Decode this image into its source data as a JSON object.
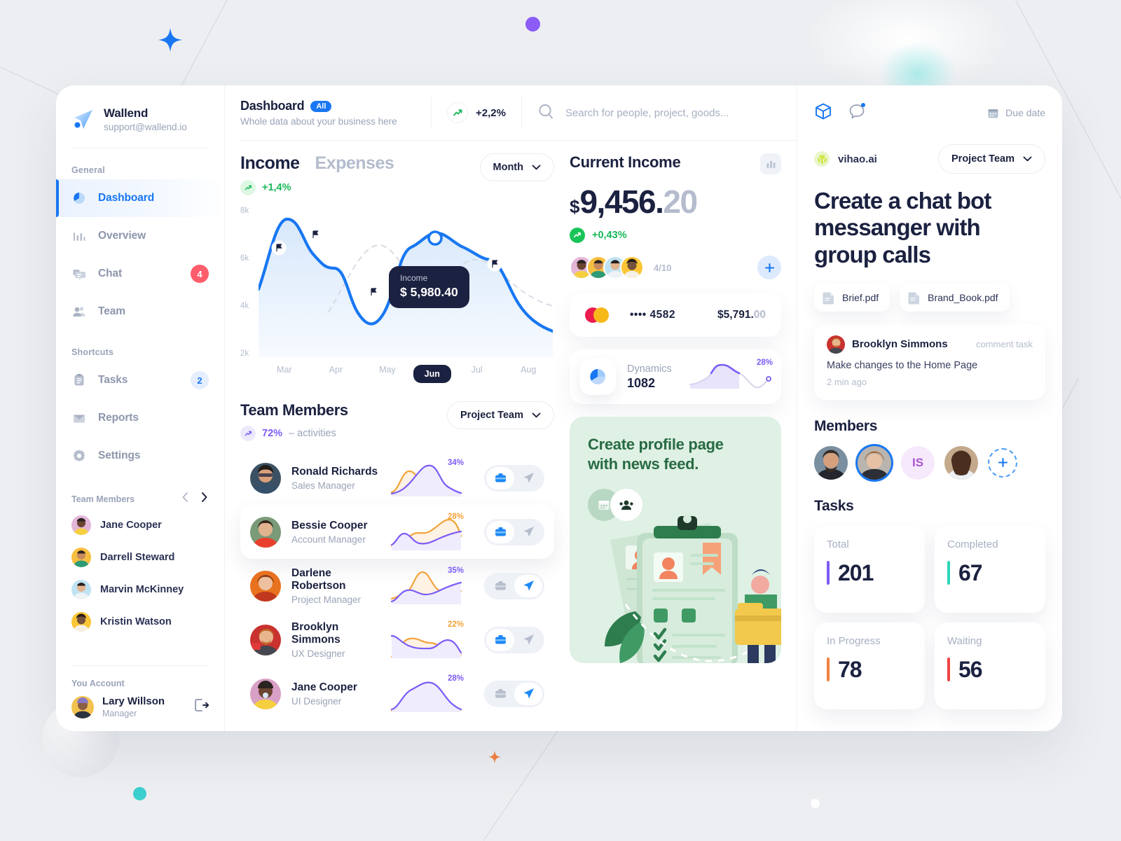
{
  "brand": {
    "name": "Wallend",
    "email": "support@wallend.io",
    "logo_icon": "paper-plane-logo"
  },
  "sidebar": {
    "sections": [
      {
        "label": "General",
        "items": [
          {
            "label": "Dashboard",
            "icon": "pie-chart-icon",
            "active": true,
            "badge": null
          },
          {
            "label": "Overview",
            "icon": "bar-chart-icon",
            "active": false,
            "badge": null
          },
          {
            "label": "Chat",
            "icon": "chat-icon",
            "active": false,
            "badge": "4",
            "badge_style": "red"
          },
          {
            "label": "Team",
            "icon": "people-icon",
            "active": false,
            "badge": null
          }
        ]
      },
      {
        "label": "Shortcuts",
        "items": [
          {
            "label": "Tasks",
            "icon": "clipboard-icon",
            "active": false,
            "badge": "2",
            "badge_style": "blue"
          },
          {
            "label": "Reports",
            "icon": "mail-icon",
            "active": false,
            "badge": null
          },
          {
            "label": "Settings",
            "icon": "gear-icon",
            "active": false,
            "badge": null
          }
        ]
      }
    ],
    "team_members_label": "Team Members",
    "team_members": [
      {
        "name": "Jane Cooper",
        "av_bg": "#e3b6d8",
        "skin": "#6b4432",
        "hair": "#2b2320"
      },
      {
        "name": "Darrell Steward",
        "av_bg": "#f7bf3f",
        "skin": "#c98b5e",
        "hair": "#2f2620"
      },
      {
        "name": "Marvin McKinney",
        "av_bg": "#bfe3f2",
        "skin": "#e3b48e",
        "hair": "#241f1c"
      },
      {
        "name": "Kristin Watson",
        "av_bg": "#fbc536",
        "skin": "#74513a",
        "hair": "#241b16"
      }
    ],
    "account_label": "You Account",
    "account": {
      "name": "Lary Willson",
      "role": "Manager",
      "av_bg": "#f2c24e",
      "logout_icon": "logout-icon"
    }
  },
  "topbar": {
    "title": "Dashboard",
    "pill": "All",
    "subtitle": "Whole data about your business here",
    "trend": {
      "value": "+2,2%",
      "icon": "trend-up-icon"
    },
    "search": {
      "placeholder": "Search for people, project, goods...",
      "value": "",
      "icon": "search-icon"
    }
  },
  "income_panel": {
    "tabs": [
      {
        "label": "Income",
        "active": true
      },
      {
        "label": "Expenses",
        "active": false
      }
    ],
    "growth": "+1,4%",
    "period_dropdown": "Month",
    "tooltip": {
      "label": "Income",
      "value": "$ 5,980.40"
    }
  },
  "chart_data": {
    "type": "line",
    "title": "Income",
    "xlabel": "",
    "ylabel": "",
    "categories": [
      "Mar",
      "Apr",
      "May",
      "Jun",
      "Jul",
      "Aug"
    ],
    "ytick_labels": [
      "2k",
      "4k",
      "6k",
      "8k"
    ],
    "ylim": [
      2000,
      8000
    ],
    "grid": false,
    "legend": "none",
    "active_category": "Jun",
    "annotation": {
      "label": "Income",
      "value": "$ 5,980.40",
      "at_category": "Jun"
    },
    "series": [
      {
        "name": "Income",
        "style": "solid",
        "color": "#1877f2",
        "x": [
          "Mar",
          "Mar+",
          "Apr",
          "Apr+",
          "May",
          "May+",
          "Jun",
          "Jun+",
          "Jul",
          "Jul+",
          "Aug"
        ],
        "values": [
          5100,
          7600,
          6700,
          5300,
          5200,
          3200,
          5950,
          6900,
          6400,
          5300,
          2700
        ]
      },
      {
        "name": "Expenses",
        "style": "dashed",
        "color": "#d4d9e3",
        "x": [
          "Mar",
          "Apr",
          "May",
          "Jun",
          "Jul",
          "Aug"
        ],
        "values": [
          3300,
          4200,
          6200,
          7200,
          5000,
          4500
        ]
      }
    ],
    "flag_markers": [
      {
        "category": "Mar+",
        "value": 6200
      },
      {
        "category": "Apr",
        "value": 7000
      },
      {
        "category": "May",
        "value": 4000
      },
      {
        "category": "Jul",
        "value": 5300
      }
    ]
  },
  "team_panel": {
    "title": "Team Members",
    "activity_pct": "72%",
    "activity_suffix": "– activities",
    "dropdown": "Project Team",
    "rows": [
      {
        "name": "Ronald Richards",
        "role": "Sales Manager",
        "pct": "34%",
        "pct_color": "#7c5cf5",
        "toggle": "left",
        "highlight": false,
        "av_bg": "#3b5163",
        "skin": "#d8a07a",
        "hair": "#211b18"
      },
      {
        "name": "Bessie Cooper",
        "role": "Account Manager",
        "pct": "28%",
        "pct_color": "#f3a33c",
        "toggle": "left",
        "highlight": true,
        "av_bg": "#7a9a78",
        "skin": "#e2b38f",
        "hair": "#36261c"
      },
      {
        "name": "Darlene Robertson",
        "role": "Project Manager",
        "pct": "35%",
        "pct_color": "#7c5cf5",
        "toggle": "right",
        "highlight": false,
        "av_bg": "#e8721f",
        "skin": "#edc0a0",
        "hair": "#8d3c17"
      },
      {
        "name": "Brooklyn Simmons",
        "role": "UX Designer",
        "pct": "22%",
        "pct_color": "#f3a33c",
        "toggle": "left",
        "highlight": false,
        "av_bg": "#c9322e",
        "skin": "#e8b68d",
        "hair": "#c06a2a"
      },
      {
        "name": "Jane Cooper",
        "role": "UI Designer",
        "pct": "28%",
        "pct_color": "#7c5cf5",
        "toggle": "right",
        "highlight": false,
        "av_bg": "#d9a0c6",
        "skin": "#6b4432",
        "hair": "#2b2320"
      }
    ]
  },
  "current_income": {
    "title": "Current Income",
    "chart_icon": "bar-chart-icon",
    "currency": "$",
    "amount_main": "9,456.",
    "amount_decimals": "20",
    "growth": "+0,43%",
    "people_ratio": "4",
    "people_total": "/10",
    "add_icon": "plus-icon",
    "avatars": [
      {
        "av_bg": "#e3b6d8",
        "skin": "#6b4432"
      },
      {
        "av_bg": "#f7bf3f",
        "skin": "#c98b5e"
      },
      {
        "av_bg": "#bfe3f2",
        "skin": "#e3b48e"
      },
      {
        "av_bg": "#fbc536",
        "skin": "#74513a"
      }
    ],
    "payment": {
      "brand_icon": "mastercard-icon",
      "masked": "•••• 4582",
      "amount_main": "$5,791.",
      "amount_decimals": "00"
    }
  },
  "dynamics": {
    "icon": "pie-chart-icon",
    "label": "Dynamics",
    "value": "1082",
    "pct": "28%"
  },
  "promo": {
    "title_line1": "Create profile page",
    "title_line2": "with news feed.",
    "icons": [
      "calendar-icon",
      "group-icon"
    ]
  },
  "right_panel": {
    "top_icons": [
      "cube-icon",
      "comment-icon"
    ],
    "due_date": {
      "label": "Due date",
      "icon": "calendar-icon"
    },
    "org": {
      "name": "vihao.ai",
      "dot_icon": "tennis-ball-icon"
    },
    "team_dropdown": "Project Team",
    "task_title": "Create a chat bot messanger with group calls",
    "files": [
      {
        "name": "Brief.pdf",
        "icon": "file-icon"
      },
      {
        "name": "Brand_Book.pdf",
        "icon": "file-icon"
      }
    ],
    "comment": {
      "author": "Brooklyn Simmons",
      "tag": "comment task",
      "text": "Make changes to the Home Page",
      "time": "2 min ago"
    },
    "members_title": "Members",
    "members": [
      {
        "type": "photo",
        "av_bg": "#7a8fa0",
        "skin": "#d6a07c",
        "hair": "#3a2a20",
        "selected": false
      },
      {
        "type": "photo",
        "av_bg": "#b9b4ae",
        "skin": "#e6c1a4",
        "hair": "#a0622c",
        "selected": true
      },
      {
        "type": "initials",
        "initials": "IS",
        "selected": false
      },
      {
        "type": "photo",
        "av_bg": "#c5a98c",
        "skin": "#e8c2a4",
        "hair": "#4a2f1f",
        "selected": false
      }
    ],
    "add_member_icon": "plus-icon",
    "tasks_title": "Tasks",
    "tasks": [
      {
        "label": "Total",
        "value": "201",
        "color": "#7c5cf5"
      },
      {
        "label": "Completed",
        "value": "67",
        "color": "#2fd6b8"
      },
      {
        "label": "In Progress",
        "value": "78",
        "color": "#f2813f"
      },
      {
        "label": "Waiting",
        "value": "56",
        "color": "#ef4444"
      }
    ]
  },
  "theme": {
    "accent_blue": "#1877f2",
    "green": "#18b85a",
    "purple": "#7c5cf5",
    "orange": "#f3a33c",
    "dark": "#1b2140",
    "muted": "#9aa3b8",
    "page_bg": "#eceef1"
  }
}
